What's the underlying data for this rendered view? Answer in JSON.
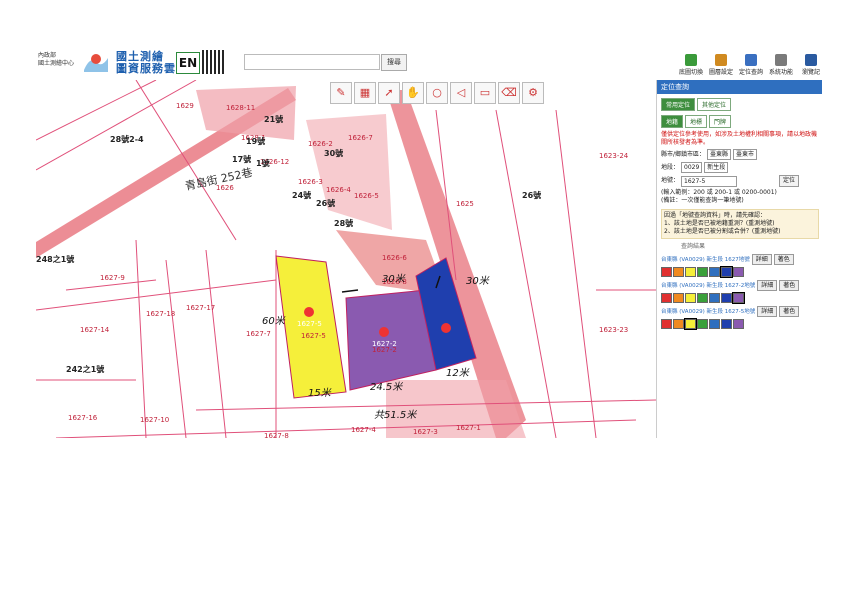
{
  "header": {
    "org_line1": "內政部",
    "org_line2": "國土測繪中心",
    "brand_line1": "國土測繪",
    "brand_line2": "圖資服務雲",
    "lang_button": "EN",
    "search_button": "搜尋",
    "tools": [
      {
        "label": "底圖切換",
        "color": "#3a9a3a"
      },
      {
        "label": "圖層設定",
        "color": "#d08a20"
      },
      {
        "label": "定位查詢",
        "color": "#3a6fc0"
      },
      {
        "label": "系統功能",
        "color": "#7a7a7a"
      },
      {
        "label": "瀏覽記",
        "color": "#2a5aa0"
      }
    ]
  },
  "map": {
    "street": "青島街 252巷",
    "parcels": [
      "1629",
      "1628-11",
      "1628-1",
      "1626-12",
      "1626-3",
      "1626-2",
      "1626-7",
      "1626-4",
      "1626-5",
      "1626",
      "1625",
      "1626-6",
      "1626-8",
      "1627-9",
      "1627-18",
      "1627-17",
      "1627-7",
      "1627-5",
      "1627-2",
      "1627-14",
      "1627-16",
      "1627-10",
      "1627-8",
      "1627-4",
      "1627-3",
      "1627-1",
      "1623-24",
      "1623-23"
    ],
    "house_numbers": [
      "28號2-4",
      "19號",
      "17號",
      "1號",
      "21號",
      "30號",
      "24號",
      "26號",
      "28號",
      "248之1號",
      "242之1號",
      "26號"
    ],
    "markers": [
      "1627-5",
      "1627-2"
    ],
    "annotations": [
      "60米",
      "30米",
      "30米",
      "15米",
      "24.5米",
      "12米",
      "共51.5米"
    ],
    "colors": {
      "yellow": "#f5ef3a",
      "purple": "#8a5ab0",
      "blue": "#1f3fae",
      "pink": "#f0a0a8",
      "road": "#e7707a"
    }
  },
  "panel": {
    "title": "定位查詢",
    "tabs": [
      "常用定位",
      "其他定位"
    ],
    "subtabs": [
      "地籍",
      "地標",
      "門牌"
    ],
    "warning": "僅供定位參考使用，如涉及土地權利相關事項，請以地政機關所核發者為準。",
    "county_label": "縣市/鄉鎮市區：",
    "county_value": "臺東縣",
    "district_value": "臺東市",
    "section_label": "地段：",
    "section_value": "0029",
    "section_name": "新生段",
    "parcel_label": "地號：",
    "parcel_value": "1627-5",
    "locate_button": "定位",
    "hint1": "(輸入範例：200 或 200-1 或 0200-0001)",
    "hint2": "(備註：一次僅能查詢一筆地號)",
    "note_title": "因過「地號查詢資料」時，請先確認：",
    "note1": "1、該土地是否已被地籍重測？(重測地號)",
    "note2": "2、該土地是否已被分割或合併？(重測地號)",
    "results_title": "查詢結果",
    "results": [
      {
        "label": "台東縣 (VA0029) 新生段 1627地號",
        "detail": "詳細",
        "color": "著色",
        "active": "#1f3fae"
      },
      {
        "label": "台東縣 (VA0029) 新生段 1627-2地號",
        "detail": "詳細",
        "color": "著色",
        "active": "#8a5ab0"
      },
      {
        "label": "台東縣 (VA0029) 新生段 1627-5地號",
        "detail": "詳細",
        "color": "著色",
        "active": "#f5ef3a"
      }
    ],
    "palette": [
      "#e03030",
      "#f08a20",
      "#f5ef3a",
      "#3aa03a",
      "#2f6fbf",
      "#1f3fae",
      "#8a5ab0"
    ]
  }
}
